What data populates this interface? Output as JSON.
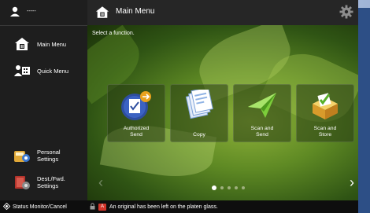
{
  "header": {
    "title": "Main Menu"
  },
  "user": {
    "name": "-----"
  },
  "sidebar": {
    "main_menu": "Main Menu",
    "quick_menu": "Quick Menu",
    "personal_settings": [
      "Personal",
      "Settings"
    ],
    "dest_fwd_settings": [
      "Dest./Fwd.",
      "Settings"
    ]
  },
  "main": {
    "instruction": "Select a function.",
    "tiles": [
      {
        "label": [
          "Authorized",
          "Send"
        ],
        "icon": "authorized-send-icon"
      },
      {
        "label": [
          "Copy"
        ],
        "icon": "copy-icon"
      },
      {
        "label": [
          "Scan and",
          "Send"
        ],
        "icon": "scan-and-send-icon"
      },
      {
        "label": [
          "Scan and",
          "Store"
        ],
        "icon": "scan-and-store-icon"
      }
    ],
    "page_indicator": {
      "current": 1,
      "total": 5
    }
  },
  "status": {
    "monitor_label": "Status Monitor/Cancel",
    "message": "An original has been left on the platen glass.",
    "error_code": "A"
  },
  "colors": {
    "accent": "#3b5da8",
    "warning": "#d2342a"
  }
}
